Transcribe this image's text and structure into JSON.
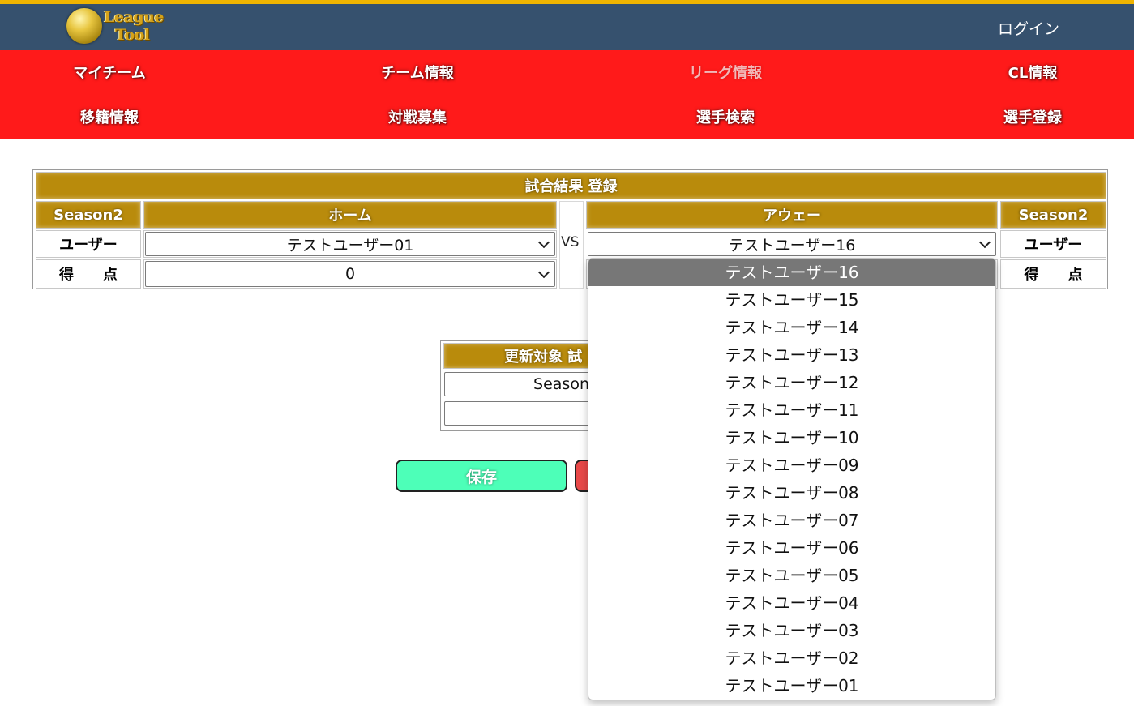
{
  "header": {
    "logo_line1": "League",
    "logo_line2": "Tool",
    "login": "ログイン"
  },
  "nav": {
    "row1": [
      "マイチーム",
      "チーム情報",
      "リーグ情報",
      "CL情報"
    ],
    "row2": [
      "移籍情報",
      "対戦募集",
      "選手検索",
      "選手登録"
    ],
    "active": "リーグ情報"
  },
  "match": {
    "title": "試合結果 登録",
    "season_left": "Season2",
    "season_right": "Season2",
    "home_header": "ホーム",
    "away_header": "アウェー",
    "user_label_left": "ユーザー",
    "user_label_right": "ユーザー",
    "score_label_left": "得　　点",
    "score_label_right": "得　　点",
    "home_user": "テストユーザー01",
    "home_score": "0",
    "vs": "VS",
    "away_user": "テストユーザー16"
  },
  "update": {
    "header": "更新対象 試",
    "season_value": "Season",
    "second_value": ""
  },
  "buttons": {
    "save": "保存"
  },
  "dropdown": {
    "selected": "テストユーザー16",
    "options": [
      "テストユーザー16",
      "テストユーザー15",
      "テストユーザー14",
      "テストユーザー13",
      "テストユーザー12",
      "テストユーザー11",
      "テストユーザー10",
      "テストユーザー09",
      "テストユーザー08",
      "テストユーザー07",
      "テストユーザー06",
      "テストユーザー05",
      "テストユーザー04",
      "テストユーザー03",
      "テストユーザー02",
      "テストユーザー01"
    ]
  },
  "colors": {
    "header_bg": "#36516e",
    "header_top_border": "#f0b400",
    "nav_bg": "#ff1a1a",
    "gold": "#b98b0c",
    "save_button": "#4dffb8",
    "delete_button": "#e84848"
  }
}
